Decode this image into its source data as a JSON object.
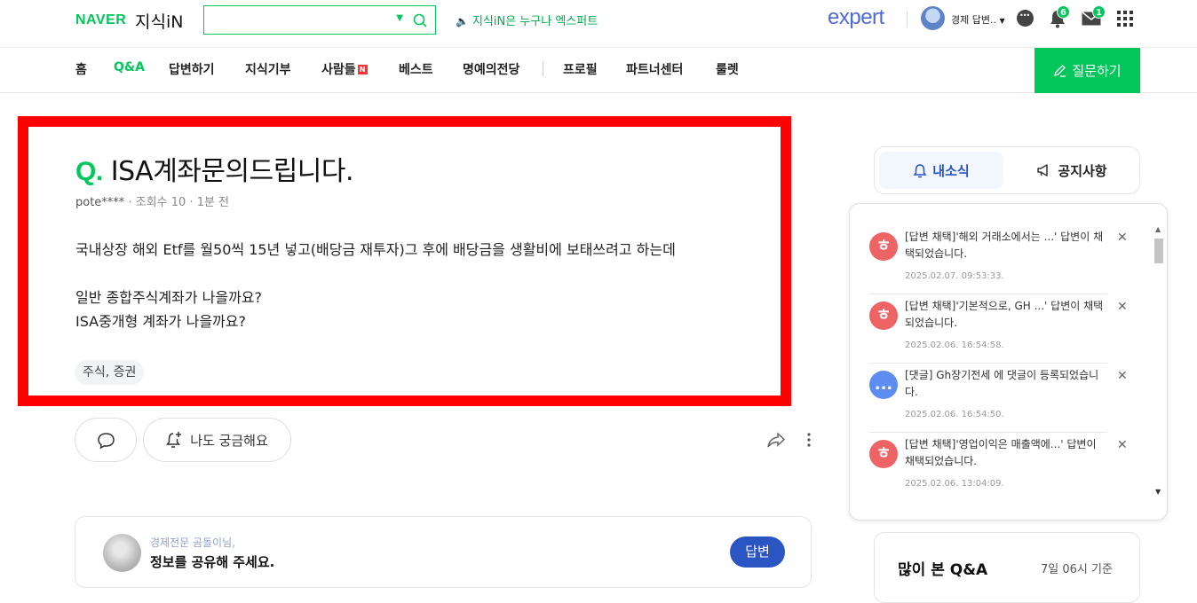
{
  "header": {
    "logo_naver": "NAVER",
    "logo_service": "지식iN",
    "search_placeholder": "",
    "notice": "지식iN은 누구나 엑스퍼트",
    "expert_logo": "expert",
    "user_name": "경제 답변..",
    "notification_count": "6",
    "mail_count": "1"
  },
  "nav": {
    "items": [
      "홈",
      "Q&A",
      "답변하기",
      "지식기부",
      "사람들",
      "베스트",
      "명예의전당",
      "프로필",
      "파트너센터",
      "룰렛"
    ],
    "active": "Q&A",
    "new_badge": "N",
    "ask_button": "질문하기"
  },
  "question": {
    "q_mark": "Q.",
    "title": "ISA계좌문의드립니다.",
    "author": "pote****",
    "views": "조회수 10",
    "time": "1분 전",
    "body": [
      "국내상장 해외 Etf를 월50씩 15년 넣고(배당금 재투자)그 후에 배당금을 생활비에 보태쓰려고 하는데",
      "",
      "일반 종합주식계좌가 나을까요?",
      "ISA중개형 계좌가 나을까요?"
    ],
    "tag": "주식, 증권",
    "curious_label": "나도 궁금해요"
  },
  "answer_prompt": {
    "small": "경제전문 곰돌이님,",
    "big": "정보를 공유해 주세요.",
    "button": "답변"
  },
  "sidebar": {
    "tab_news": "내소식",
    "tab_notice": "공지사항",
    "notifications": [
      {
        "type": "adopt",
        "icon": "ㅎ",
        "text": "[답변 채택]'해외 거래소에서는 ...' 답변이 채택되었습니다.",
        "date": "2025.02.07. 09:53:33."
      },
      {
        "type": "adopt",
        "icon": "ㅎ",
        "text": "[답변 채택]'기본적으로, GH ...' 답변이 채택되었습니다.",
        "date": "2025.02.06. 16:54:58."
      },
      {
        "type": "comment",
        "icon": "...",
        "text": "[댓글] Gh장기전세 에 댓글이 등록되었습니다.",
        "date": "2025.02.06. 16:54:50."
      },
      {
        "type": "adopt",
        "icon": "ㅎ",
        "text": "[답변 채택]'영업이익은 매출액에...' 답변이 채택되었습니다.",
        "date": "2025.02.06. 13:04:09."
      }
    ],
    "most_viewed_title": "많이 본 Q&A",
    "most_viewed_time": "7일 06시 기준"
  },
  "colors": {
    "naver_green": "#03c75a",
    "expert_blue": "#4f6ad8",
    "answer_blue": "#2c55c4",
    "highlight_red": "#ff0000"
  }
}
